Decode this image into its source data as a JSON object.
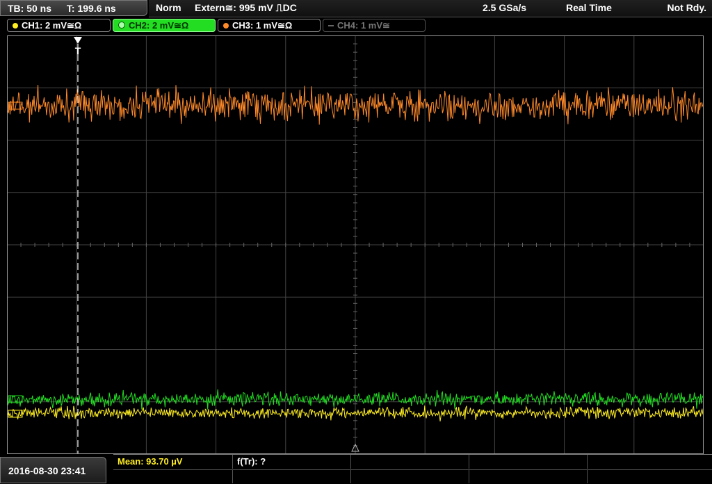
{
  "timebase": {
    "tb": "TB: 50 ns",
    "t": "T: 199.6 ns"
  },
  "status": {
    "mode": "Norm",
    "trigger": "Extern≅: 995 mV ⎍DC",
    "sample_rate": "2.5 GSa/s",
    "acq": "Real Time",
    "state": "Not Rdy."
  },
  "channels": [
    {
      "label": "CH1: 2 mV≅Ω",
      "color": "#ffee22",
      "state": "on"
    },
    {
      "label": "CH2: 2 mV≅Ω",
      "color": "#22dd22",
      "state": "active"
    },
    {
      "label": "CH3: 1 mV≅Ω",
      "color": "#ff8a2a",
      "state": "on"
    },
    {
      "label": "CH4: 1 mV≅",
      "color": "#777777",
      "state": "off"
    }
  ],
  "trigger_marker": "T",
  "datetime": "2016-08-30 23:41",
  "measurements": {
    "mean": "Mean: 93.70 µV",
    "ftr": "f(Tr): ?"
  },
  "colors": {
    "ch1": "#ffee22",
    "ch2": "#22dd22",
    "ch3": "#ff8a2a",
    "grid": "#444444"
  }
}
